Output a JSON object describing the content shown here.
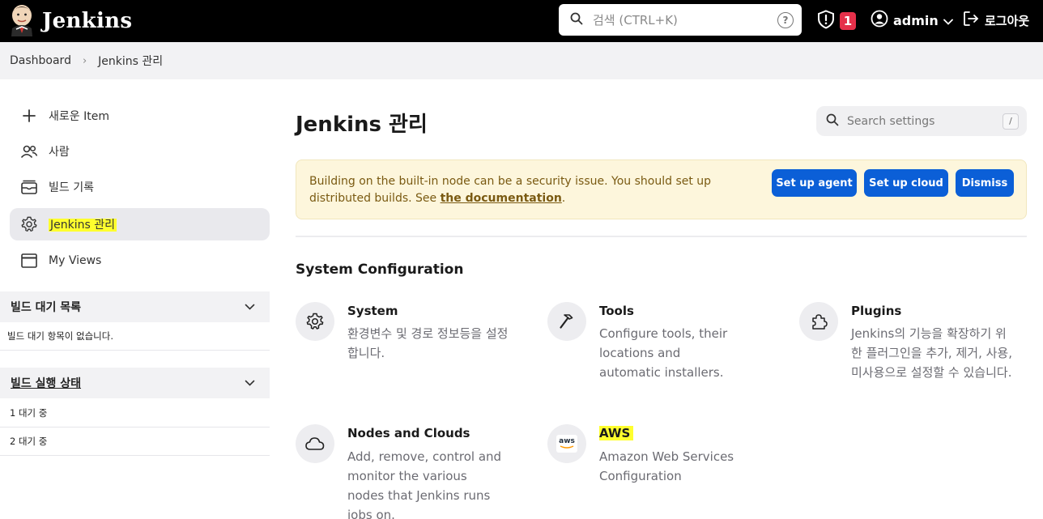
{
  "header": {
    "app_title": "Jenkins",
    "search_placeholder": "검색 (CTRL+K)",
    "help_symbol": "?",
    "security_badge_count": "1",
    "username": "admin",
    "logout_label": "로그아웃"
  },
  "breadcrumb": {
    "items": [
      "Dashboard",
      "Jenkins 관리"
    ],
    "separator": "›"
  },
  "sidebar": {
    "items": [
      {
        "label": "새로운 Item",
        "icon": "plus-icon"
      },
      {
        "label": "사람",
        "icon": "people-icon"
      },
      {
        "label": "빌드 기록",
        "icon": "build-history-icon"
      },
      {
        "label": "Jenkins 관리",
        "icon": "gear-icon",
        "active": true
      },
      {
        "label": "My Views",
        "icon": "window-icon"
      }
    ],
    "queue": {
      "title": "빌드 대기 목록",
      "empty_text": "빌드 대기 항목이 없습니다."
    },
    "executors": {
      "title": "빌드 실행 상태",
      "rows": [
        "1  대기 중",
        "2  대기 중"
      ]
    }
  },
  "main": {
    "title": "Jenkins 관리",
    "search_placeholder": "Search settings",
    "search_shortcut": "/",
    "alert": {
      "text": "Building on the built-in node can be a security issue. You should set up distributed builds. See ",
      "link": "the documentation",
      "suffix": ".",
      "buttons": [
        "Set up agent",
        "Set up cloud",
        "Dismiss"
      ]
    },
    "section_title": "System Configuration",
    "cards": [
      {
        "title": "System",
        "desc": "환경변수 및 경로 정보등을 설정합니다.",
        "icon": "gear-icon"
      },
      {
        "title": "Tools",
        "desc": "Configure tools, their locations and automatic installers.",
        "icon": "hammer-icon"
      },
      {
        "title": "Plugins",
        "desc": "Jenkins의 기능을 확장하기 위한 플러그인을 추가, 제거, 사용, 미사용으로 설정할 수 있습니다.",
        "icon": "puzzle-icon"
      },
      {
        "title": "Nodes and Clouds",
        "desc": "Add, remove, control and monitor the various nodes that Jenkins runs jobs on.",
        "icon": "cloud-icon"
      },
      {
        "title": "AWS",
        "desc": "Amazon Web Services Configuration",
        "icon": "aws-icon",
        "icon_text": "aws"
      }
    ]
  },
  "colors": {
    "header_bg": "#000000",
    "accent_button": "#0b5fd7",
    "alert_bg": "#fdf6dc",
    "badge_red": "#e5304a",
    "highlight": "#ffff2e"
  }
}
